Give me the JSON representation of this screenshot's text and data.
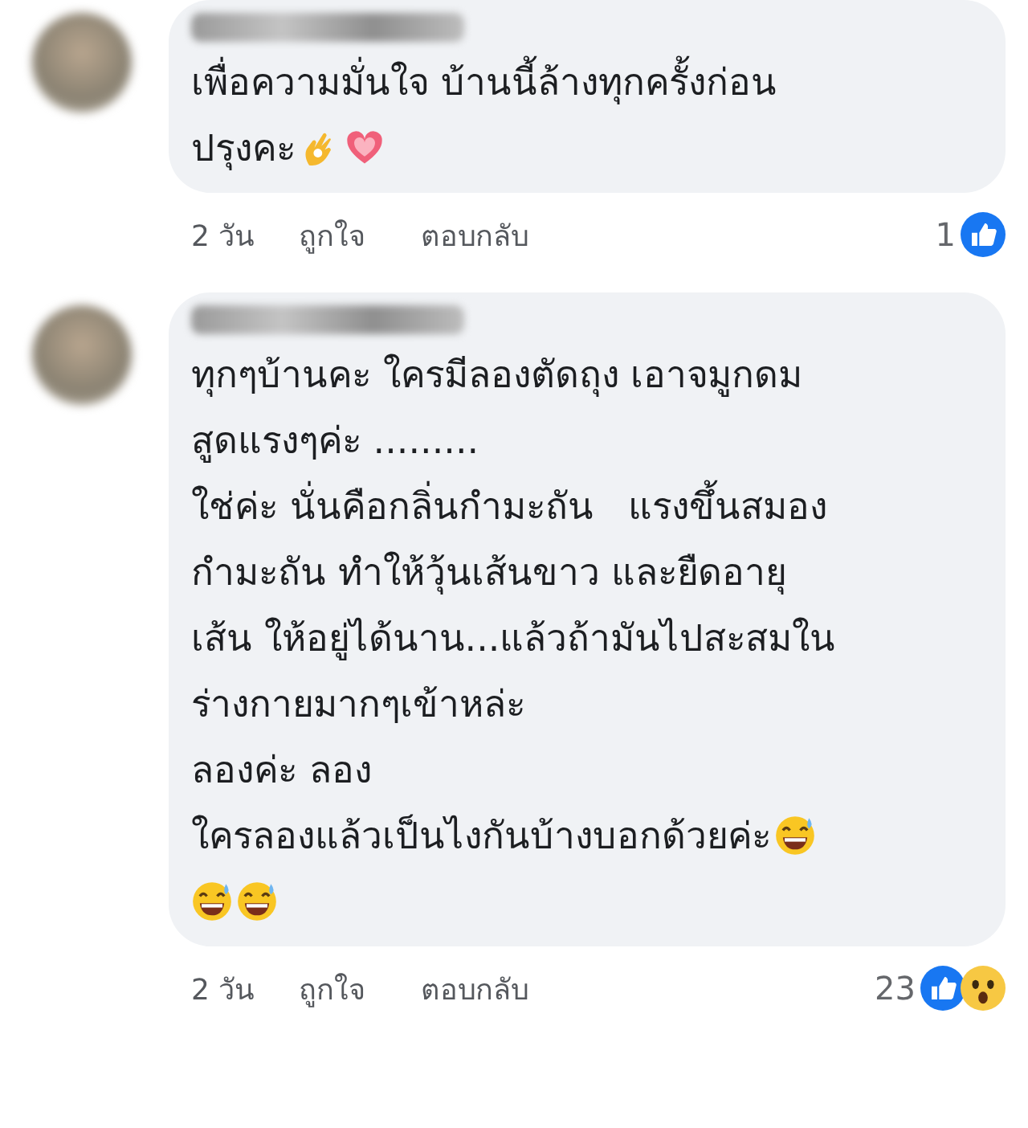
{
  "comments": [
    {
      "lines": [
        {
          "text": "เพื่อความมั่นใจ บ้านนี้ล้างทุกครั้งก่อน"
        },
        {
          "text": "ปรุงคะ",
          "emojis": [
            {
              "kind": "ok-hand"
            },
            {
              "kind": "heart"
            }
          ]
        }
      ],
      "time": "2 วัน",
      "like_action": "ถูกใจ",
      "reply_action": "ตอบกลับ",
      "reaction_count": "1",
      "reactions": [
        {
          "kind": "like"
        }
      ]
    },
    {
      "lines": [
        {
          "text": "ทุกๆบ้านคะ ใครมีลองตัดถุง เอาจมูกดม"
        },
        {
          "text": "สูดแรงๆค่ะ ........."
        },
        {
          "text": "ใช่ค่ะ นั่นคือกลิ่นกำมะถัน   แรงขึ้นสมอง"
        },
        {
          "text": "กำมะถัน ทำให้วุ้นเส้นขาว และยืดอายุ"
        },
        {
          "text": "เส้น ให้อยู่ได้นาน...แล้วถ้ามันไปสะสมใน"
        },
        {
          "text": "ร่างกายมากๆเข้าหล่ะ"
        },
        {
          "text": "ลองค่ะ ลอง"
        },
        {
          "text": "ใครลองแล้วเป็นไงกันบ้างบอกด้วยค่ะ",
          "emojis": [
            {
              "kind": "sweat-smile"
            }
          ]
        },
        {
          "emojis": [
            {
              "kind": "sweat-smile"
            },
            {
              "kind": "sweat-smile"
            }
          ]
        }
      ],
      "time": "2 วัน",
      "like_action": "ถูกใจ",
      "reply_action": "ตอบกลับ",
      "reaction_count": "23",
      "reactions": [
        {
          "kind": "like"
        },
        {
          "kind": "wow"
        }
      ]
    }
  ]
}
